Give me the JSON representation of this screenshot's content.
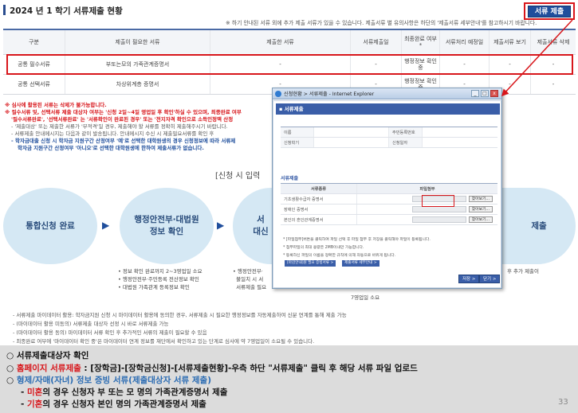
{
  "header": {
    "title": "2024 년 1 학기 서류제출 현황",
    "submit_button": "서류 제출",
    "notice": "※ 하기 안내된 서류 외에 추가 제출 서류가 있을 수 있습니다. 제출서류 별 유의사항은 하단의 '제출서류 세부안내'를 참고하시기 바랍니다."
  },
  "table": {
    "columns": [
      "구분",
      "제출이 필요한 서류",
      "제출한 서류",
      "서류제출일",
      "최종완료 여부 *",
      "서류처리 예정일",
      "제출서류 보기",
      "제출서류 삭제"
    ],
    "rows": [
      [
        "공통 필수서류",
        "부또는모의 가족관계증명서",
        "-",
        "-",
        "행정정보 확인중",
        "-",
        "-",
        "-"
      ],
      [
        "공통 선택서류",
        "차상위계층 증명서",
        "-",
        "-",
        "행정정보 확인중",
        "-",
        "-",
        "-"
      ]
    ]
  },
  "notes": {
    "red1": "※ 심사에 활용된 서류는 삭제가 불가능합니다.",
    "red2": "※ 필수서류 및, 선택서류 제출 대상자 여부는 '신청 2일~4일 영업일 후 확인'하실 수 있으며, 최종완료 여부",
    "red3": "'필수서류완료', '선택서류완료' 는 '서류확인이 완료된 경우' 또는 '전지자격 확인으로 소득인정액 산정",
    "gray1": "- '제출대상' 또는 제출한 서류가 '부적격'일 경우, 제출해야 할 서류를 정확히 제출해주시기 바랍니다.",
    "gray2": "- 서류제출 안내메시지는 다음과 같이 발송됩니다. 안내메시지 수신 시 제출필요서류를 확인 후",
    "blue1": "- 학자금대출 신청 시 학자금 지원구간 산정여부 '예'로 선택한 대학원생의 경우 신청정보에 따라 서류제",
    "blue2": "학자금 지원구간 산정여부 '아니오'로 선택한 대학원생에 한하여 제출서류가 없습니다."
  },
  "process": {
    "heading": "[신청 시 입력",
    "step1": "통합신청 완료",
    "step2_line1": "행정안전부·대법원",
    "step2_line2": "정보 확인",
    "step3_line1": "서",
    "step3_line2": "대신",
    "step4": "제출",
    "bullets_left": [
      "정보 확인 완료까지 2~3영업일 소요",
      "행정안전부·주민등록 전산정보 확인",
      "대법원 가족관계 등록정보 확인"
    ],
    "bullets_mid": [
      "행정안전부·",
      "불일치 시 서",
      "서류제출 필요"
    ],
    "right_fragment": "후 추가 제출이",
    "right_fragment2": "7영업일 소요"
  },
  "footer_notes": [
    "- 서류제출 마이데이터 활용: 학자금지원 신청 시 마이데이터 활용에 동의한 경우, 서류제출 시 필요한 행정정보를 자동제출하여 신분 연계를 통해 제출 가능",
    "- (마이데이터 활용 미동의) 서류제출 대상자 선정 시 바로 서류제출 가능",
    "- (마이데이터 활용 동의) 마이데이터 서류 확인 후 추가적인 서류의 제출이 필요할 수 있음",
    "- 최종완료 여부에 '마이데이터 확인 중'은 마이데이터 연계 정보를 재단에서 확인하고 있는 단계로 심사에 약 7영업일이 소요될 수 있습니다."
  ],
  "popup": {
    "window_title": "신청현황 > 서류제출 - Internet Explorer",
    "header": "▪ 서류제출",
    "info_rows": [
      [
        "이름",
        "",
        "주민등록번호",
        ""
      ],
      [
        "신청학기",
        "",
        "신청일자",
        ""
      ]
    ],
    "section_title": "서류제출",
    "doc_columns": [
      "서류종류",
      "파일첨부"
    ],
    "doc_rows": [
      "기초생활수급자 증명서",
      "장애인 증명서",
      "본인의 혼인관계증명서"
    ],
    "find_button": "찾아보기...",
    "notes": [
      "* [파일첨부]버튼을 클릭하여 파일 선택 후 파일 첨부 후 저장을 클릭해야 파일이 등록됩니다.",
      "* 첨부파일의 최대 용량은 2MB이내만 가능합니다.",
      "* 등록하신 파일의 이름을 정확한 규칙에 의해 자동으로 바뀌게 됩니다."
    ],
    "chips": [
      "[마감안내]원 필요 증빙서류 >",
      "제출서류 세부안내 >"
    ],
    "save_button": "저장 >",
    "close_button": "닫기 >",
    "win_minimize": "_",
    "win_maximize": "□",
    "win_close": "x"
  },
  "bottom": {
    "line1": "○ 서류제출대상자 확인",
    "line2_prefix": "○ ",
    "line2_red": "홈페이지 서류제출",
    "line2_rest": " : [장학금]-[장학금신청]-[서류제출현황]-우측 하단 \"서류제출\" 클릭 후 해당 서류 파일 업로드",
    "line3_prefix": "○ ",
    "line3_blue": "형제/자매(자녀) 정보 증빙 서류(제출대상자 서류 제출)",
    "line4_prefix": "- ",
    "line4_red": "미혼",
    "line4_rest": "의 경우 신청자 부 또는 모 명의 가족관계증명서 제출",
    "line5_prefix": "- ",
    "line5_red": "기혼",
    "line5_rest": "의 경우 신청자 본인 명의 가족관계증명서 제출",
    "page_number": "33"
  },
  "colors": {
    "accent": "#1f4e9c",
    "highlight": "#d8161b",
    "circle": "#d5e8f4"
  }
}
